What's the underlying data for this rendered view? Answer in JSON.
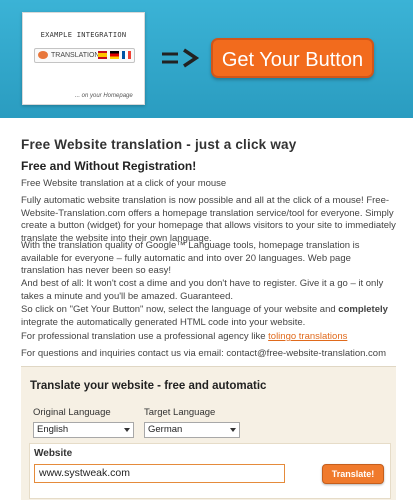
{
  "banner": {
    "example_title": "EXAMPLE INTEGRATION",
    "translation_label": "TRANSLATION",
    "homepage_text": "... on your Homepage",
    "get_button_label": "Get Your Button",
    "colors": {
      "banner": "#2ba6c9",
      "button": "#f26b1d"
    },
    "icons": [
      "speech-bubble-icon",
      "flag-spain-icon",
      "flag-germany-icon",
      "flag-france-icon",
      "arrow-right-icon"
    ]
  },
  "content": {
    "title": "Free Website translation - just a click way",
    "subtitle": "Free and Without Registration!",
    "p1": "Free Website translation at a click of your mouse",
    "p2": "Fully automatic website translation is now possible and all at the click of a mouse!  Free-Website-Translation.com offers a homepage translation service/tool for everyone.  Simply create a button (widget) for your homepage that allows visitors to your site to immediately translate the website into their own language.",
    "p3": "With the translation quality of Google™ Language tools, homepage translation is available for everyone – fully automatic and into over 20 languages.  Web page translation has never been so easy!",
    "p4": "And best of all: It won't cost a dime and you don't have to register.  Give it a go – it only takes a minute and you'll be amazed.  Guaranteed.",
    "p5_a": "So click on \"Get Your Button\" now, select the language of your website and ",
    "p5_b": "completely",
    "p5_c": " integrate the automatically generated HTML code into your website.",
    "p6_text": "For professional translation use a professional agency like ",
    "p6_link": "tolingo translations",
    "p7": "For questions and inquiries contact us via email: contact@free-website-translation.com"
  },
  "widget": {
    "title": "Translate your website - free and automatic",
    "original_label": "Original Language",
    "original_value": "English",
    "target_label": "Target Language",
    "target_value": "German",
    "website_label": "Website",
    "website_value": "www.systweak.com",
    "translate_label": "Translate!"
  }
}
